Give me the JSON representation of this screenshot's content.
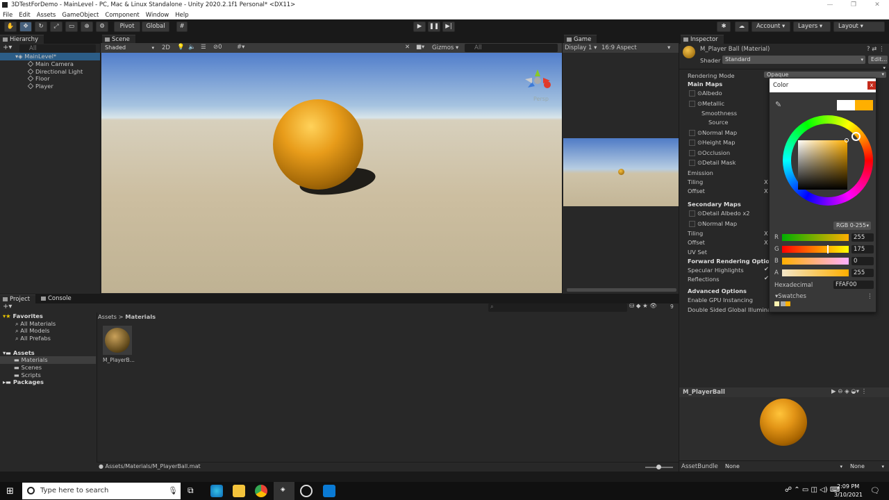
{
  "window": {
    "title": "3DTestForDemo - MainLevel - PC, Mac & Linux Standalone - Unity 2020.2.1f1 Personal* <DX11>"
  },
  "menu": [
    "File",
    "Edit",
    "Assets",
    "GameObject",
    "Component",
    "Window",
    "Help"
  ],
  "toolbar": {
    "pivot": "Pivot",
    "global": "Global",
    "account": "Account",
    "layers": "Layers",
    "layout": "Layout"
  },
  "hierarchy": {
    "tab": "Hierarchy",
    "search_placeholder": "All",
    "scene": "MainLevel*",
    "items": [
      "Main Camera",
      "Directional Light",
      "Floor",
      "Player"
    ]
  },
  "scene": {
    "tab": "Scene",
    "shading": "Shaded",
    "mode2d": "2D",
    "gizmos": "Gizmos",
    "search_placeholder": "All",
    "persp": "Persp"
  },
  "game": {
    "tab": "Game",
    "display": "Display 1",
    "aspect": "16:9 Aspect"
  },
  "project": {
    "tab_project": "Project",
    "tab_console": "Console",
    "favorites": "Favorites",
    "fav_items": [
      "All Materials",
      "All Models",
      "All Prefabs"
    ],
    "assets": "Assets",
    "asset_items": [
      "Materials",
      "Scenes",
      "Scripts"
    ],
    "packages": "Packages",
    "breadcrumb": [
      "Assets",
      "Materials"
    ],
    "file": "M_PlayerB...",
    "path": "Assets/Materials/M_PlayerBall.mat",
    "count": "9"
  },
  "inspector": {
    "tab": "Inspector",
    "material": "M_Player Ball (Material)",
    "shader_label": "Shader",
    "shader": "Standard",
    "edit": "Edit...",
    "rendering_mode": "Rendering Mode",
    "rendering_value": "Opaque",
    "main_maps": "Main Maps",
    "albedo": "Albedo",
    "metallic": "Metallic",
    "smoothness": "Smoothness",
    "source": "Source",
    "normal_map": "Normal Map",
    "height_map": "Height Map",
    "occlusion": "Occlusion",
    "detail_mask": "Detail Mask",
    "emission": "Emission",
    "tiling": "Tiling",
    "offset": "Offset",
    "x": "X",
    "secondary_maps": "Secondary Maps",
    "detail_albedo": "Detail Albedo x2",
    "normal_map2": "Normal Map",
    "tiling2": "Tiling",
    "offset2": "Offset",
    "uv_set": "UV Set",
    "forward_options": "Forward Rendering Options",
    "specular": "Specular Highlights",
    "reflections": "Reflections",
    "advanced": "Advanced Options",
    "gpu_instancing": "Enable GPU Instancing",
    "double_sided": "Double Sided Global Illuminat",
    "preview_name": "M_PlayerBall",
    "asset_bundle": "AssetBundle",
    "none1": "None",
    "none2": "None"
  },
  "color_picker": {
    "title": "Color",
    "close": "x",
    "mode": "RGB 0-255",
    "r_label": "R",
    "r": "255",
    "g_label": "G",
    "g": "175",
    "b_label": "B",
    "b": "0",
    "a_label": "A",
    "a": "255",
    "hex_label": "Hexadecimal",
    "hex": "FFAF00",
    "swatches": "Swatches",
    "color": "#FFAF00"
  },
  "taskbar": {
    "search_placeholder": "Type here to search",
    "time": "2:09 PM",
    "date": "3/10/2021"
  }
}
